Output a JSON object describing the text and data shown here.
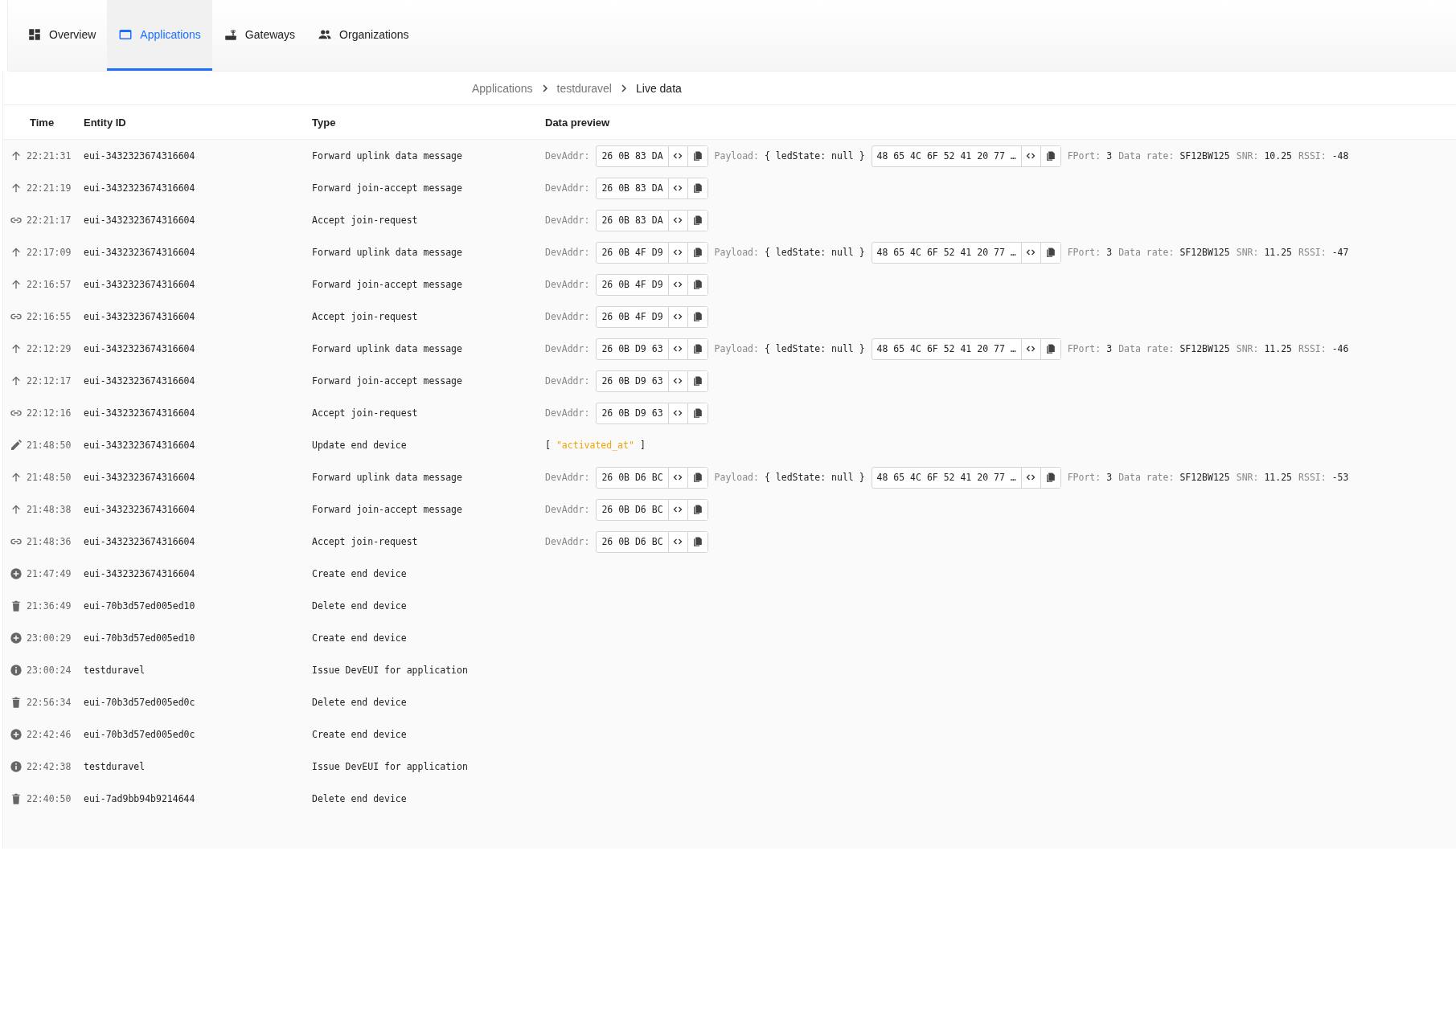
{
  "tabs": [
    {
      "label": "Overview",
      "selected": false
    },
    {
      "label": "Applications",
      "selected": true
    },
    {
      "label": "Gateways",
      "selected": false
    },
    {
      "label": "Organizations",
      "selected": false
    }
  ],
  "breadcrumb": [
    {
      "label": "Applications",
      "current": false
    },
    {
      "label": "testduravel",
      "current": false
    },
    {
      "label": "Live data",
      "current": true
    }
  ],
  "table": {
    "columns": [
      "Time",
      "Entity ID",
      "Type",
      "Data preview"
    ],
    "rows": [
      {
        "kind": "up",
        "time": "22:21:31",
        "entity": "eui-3432323674316604",
        "type": "Forward uplink data message",
        "preview": [
          {
            "kind": "field",
            "label": "DevAddr:",
            "value": "26 0B 83 DA"
          },
          {
            "kind": "pair",
            "label": "Payload:",
            "value": "{ ledState: null }"
          },
          {
            "kind": "hex",
            "value": "48 65 4C 6F 52 41 20 77 …"
          },
          {
            "kind": "pair",
            "label": "FPort:",
            "value": "3"
          },
          {
            "kind": "pair",
            "label": "Data rate:",
            "value": "SF12BW125"
          },
          {
            "kind": "pair",
            "label": "SNR:",
            "value": "10.25"
          },
          {
            "kind": "pair",
            "label": "RSSI:",
            "value": "-48"
          }
        ]
      },
      {
        "kind": "up",
        "time": "22:21:19",
        "entity": "eui-3432323674316604",
        "type": "Forward join-accept message",
        "preview": [
          {
            "kind": "field",
            "label": "DevAddr:",
            "value": "26 0B 83 DA"
          }
        ]
      },
      {
        "kind": "link",
        "time": "22:21:17",
        "entity": "eui-3432323674316604",
        "type": "Accept join-request",
        "preview": [
          {
            "kind": "field",
            "label": "DevAddr:",
            "value": "26 0B 83 DA"
          }
        ]
      },
      {
        "kind": "up",
        "time": "22:17:09",
        "entity": "eui-3432323674316604",
        "type": "Forward uplink data message",
        "preview": [
          {
            "kind": "field",
            "label": "DevAddr:",
            "value": "26 0B 4F D9"
          },
          {
            "kind": "pair",
            "label": "Payload:",
            "value": "{ ledState: null }"
          },
          {
            "kind": "hex",
            "value": "48 65 4C 6F 52 41 20 77 …"
          },
          {
            "kind": "pair",
            "label": "FPort:",
            "value": "3"
          },
          {
            "kind": "pair",
            "label": "Data rate:",
            "value": "SF12BW125"
          },
          {
            "kind": "pair",
            "label": "SNR:",
            "value": "11.25"
          },
          {
            "kind": "pair",
            "label": "RSSI:",
            "value": "-47"
          }
        ]
      },
      {
        "kind": "up",
        "time": "22:16:57",
        "entity": "eui-3432323674316604",
        "type": "Forward join-accept message",
        "preview": [
          {
            "kind": "field",
            "label": "DevAddr:",
            "value": "26 0B 4F D9"
          }
        ]
      },
      {
        "kind": "link",
        "time": "22:16:55",
        "entity": "eui-3432323674316604",
        "type": "Accept join-request",
        "preview": [
          {
            "kind": "field",
            "label": "DevAddr:",
            "value": "26 0B 4F D9"
          }
        ]
      },
      {
        "kind": "up",
        "time": "22:12:29",
        "entity": "eui-3432323674316604",
        "type": "Forward uplink data message",
        "preview": [
          {
            "kind": "field",
            "label": "DevAddr:",
            "value": "26 0B D9 63"
          },
          {
            "kind": "pair",
            "label": "Payload:",
            "value": "{ ledState: null }"
          },
          {
            "kind": "hex",
            "value": "48 65 4C 6F 52 41 20 77 …"
          },
          {
            "kind": "pair",
            "label": "FPort:",
            "value": "3"
          },
          {
            "kind": "pair",
            "label": "Data rate:",
            "value": "SF12BW125"
          },
          {
            "kind": "pair",
            "label": "SNR:",
            "value": "11.25"
          },
          {
            "kind": "pair",
            "label": "RSSI:",
            "value": "-46"
          }
        ]
      },
      {
        "kind": "up",
        "time": "22:12:17",
        "entity": "eui-3432323674316604",
        "type": "Forward join-accept message",
        "preview": [
          {
            "kind": "field",
            "label": "DevAddr:",
            "value": "26 0B D9 63"
          }
        ]
      },
      {
        "kind": "link",
        "time": "22:12:16",
        "entity": "eui-3432323674316604",
        "type": "Accept join-request",
        "preview": [
          {
            "kind": "field",
            "label": "DevAddr:",
            "value": "26 0B D9 63"
          }
        ]
      },
      {
        "kind": "pencil",
        "time": "21:48:50",
        "entity": "eui-3432323674316604",
        "type": "Update end device",
        "preview": [
          {
            "kind": "array",
            "open": "[",
            "items": [
              "\"activated_at\""
            ],
            "close": "]"
          }
        ]
      },
      {
        "kind": "up",
        "time": "21:48:50",
        "entity": "eui-3432323674316604",
        "type": "Forward uplink data message",
        "preview": [
          {
            "kind": "field",
            "label": "DevAddr:",
            "value": "26 0B D6 BC"
          },
          {
            "kind": "pair",
            "label": "Payload:",
            "value": "{ ledState: null }"
          },
          {
            "kind": "hex",
            "value": "48 65 4C 6F 52 41 20 77 …"
          },
          {
            "kind": "pair",
            "label": "FPort:",
            "value": "3"
          },
          {
            "kind": "pair",
            "label": "Data rate:",
            "value": "SF12BW125"
          },
          {
            "kind": "pair",
            "label": "SNR:",
            "value": "11.25"
          },
          {
            "kind": "pair",
            "label": "RSSI:",
            "value": "-53"
          }
        ]
      },
      {
        "kind": "up",
        "time": "21:48:38",
        "entity": "eui-3432323674316604",
        "type": "Forward join-accept message",
        "preview": [
          {
            "kind": "field",
            "label": "DevAddr:",
            "value": "26 0B D6 BC"
          }
        ]
      },
      {
        "kind": "link",
        "time": "21:48:36",
        "entity": "eui-3432323674316604",
        "type": "Accept join-request",
        "preview": [
          {
            "kind": "field",
            "label": "DevAddr:",
            "value": "26 0B D6 BC"
          }
        ]
      },
      {
        "kind": "plus",
        "time": "21:47:49",
        "entity": "eui-3432323674316604",
        "type": "Create end device"
      },
      {
        "kind": "trash",
        "time": "21:36:49",
        "entity": "eui-70b3d57ed005ed10",
        "type": "Delete end device"
      },
      {
        "kind": "plus",
        "time": "23:00:29",
        "entity": "eui-70b3d57ed005ed10",
        "type": "Create end device"
      },
      {
        "kind": "info",
        "time": "23:00:24",
        "entity": "testduravel",
        "type": "Issue DevEUI for application"
      },
      {
        "kind": "trash",
        "time": "22:56:34",
        "entity": "eui-70b3d57ed005ed0c",
        "type": "Delete end device"
      },
      {
        "kind": "plus",
        "time": "22:42:46",
        "entity": "eui-70b3d57ed005ed0c",
        "type": "Create end device"
      },
      {
        "kind": "info",
        "time": "22:42:38",
        "entity": "testduravel",
        "type": "Issue DevEUI for application"
      },
      {
        "kind": "trash",
        "time": "22:40:50",
        "entity": "eui-7ad9bb94b9214644",
        "type": "Delete end device"
      }
    ]
  }
}
